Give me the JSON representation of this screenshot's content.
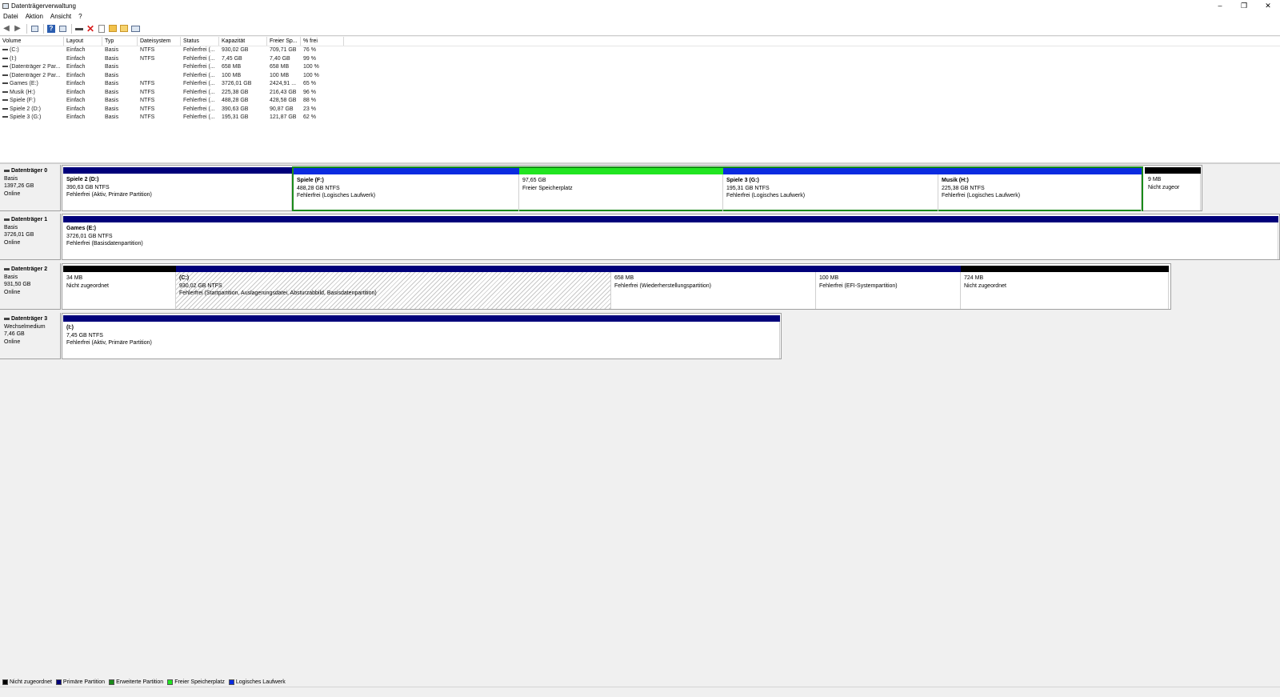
{
  "window": {
    "title": "Datenträgerverwaltung",
    "minimize": "–",
    "restore": "❐",
    "close": "✕"
  },
  "menu": [
    "Datei",
    "Aktion",
    "Ansicht",
    "?"
  ],
  "toolbar": {
    "back_icon": "arrow-left-icon",
    "forward_icon": "arrow-right-icon",
    "delete_icon": "red-x-icon"
  },
  "volume_table": {
    "headers": [
      "Volume",
      "Layout",
      "Typ",
      "Dateisystem",
      "Status",
      "Kapazität",
      "Freier Sp...",
      "% frei"
    ],
    "rows": [
      [
        "(C:)",
        "Einfach",
        "Basis",
        "NTFS",
        "Fehlerfrei (...",
        "930,02 GB",
        "709,71 GB",
        "76 %"
      ],
      [
        "(I:)",
        "Einfach",
        "Basis",
        "NTFS",
        "Fehlerfrei (...",
        "7,45 GB",
        "7,40 GB",
        "99 %"
      ],
      [
        "(Datenträger 2 Par...",
        "Einfach",
        "Basis",
        "",
        "Fehlerfrei (...",
        "658 MB",
        "658 MB",
        "100 %"
      ],
      [
        "(Datenträger 2 Par...",
        "Einfach",
        "Basis",
        "",
        "Fehlerfrei (...",
        "100 MB",
        "100 MB",
        "100 %"
      ],
      [
        "Games (E:)",
        "Einfach",
        "Basis",
        "NTFS",
        "Fehlerfrei (...",
        "3726,01 GB",
        "2424,91 ...",
        "65 %"
      ],
      [
        "Musik (H:)",
        "Einfach",
        "Basis",
        "NTFS",
        "Fehlerfrei (...",
        "225,38 GB",
        "216,43 GB",
        "96 %"
      ],
      [
        "Spiele (F:)",
        "Einfach",
        "Basis",
        "NTFS",
        "Fehlerfrei (...",
        "488,28 GB",
        "428,58 GB",
        "88 %"
      ],
      [
        "Spiele 2 (D:)",
        "Einfach",
        "Basis",
        "NTFS",
        "Fehlerfrei (...",
        "390,63 GB",
        "90,87 GB",
        "23 %"
      ],
      [
        "Spiele 3 (G:)",
        "Einfach",
        "Basis",
        "NTFS",
        "Fehlerfrei (...",
        "195,31 GB",
        "121,87 GB",
        "62 %"
      ]
    ]
  },
  "disks": [
    {
      "name": "Datenträger 0",
      "type": "Basis",
      "size": "1397,26 GB",
      "state": "Online",
      "partitions": [
        {
          "name": "Spiele 2  (D:)",
          "size": "390,63 GB NTFS",
          "status": "Fehlerfrei (Aktiv, Primäre Partition)",
          "color": "#00007a"
        },
        {
          "name": "Spiele  (F:)",
          "size": "488,28 GB NTFS",
          "status": "Fehlerfrei (Logisches Laufwerk)",
          "color": "#0a2be0"
        },
        {
          "name": "",
          "size": "97,65 GB",
          "status": "Freier Speicherplatz",
          "color": "#21e521"
        },
        {
          "name": "Spiele 3  (G:)",
          "size": "195,31 GB NTFS",
          "status": "Fehlerfrei (Logisches Laufwerk)",
          "color": "#0a2be0"
        },
        {
          "name": "Musik  (H:)",
          "size": "225,38 GB NTFS",
          "status": "Fehlerfrei (Logisches Laufwerk)",
          "color": "#0a2be0"
        },
        {
          "name": "",
          "size": "9 MB",
          "status": "Nicht zugeor",
          "color": "#000000"
        }
      ]
    },
    {
      "name": "Datenträger 1",
      "type": "Basis",
      "size": "3726,01 GB",
      "state": "Online",
      "partitions": [
        {
          "name": "Games  (E:)",
          "size": "3726,01 GB NTFS",
          "status": "Fehlerfrei (Basisdatenpartition)",
          "color": "#00007a"
        }
      ]
    },
    {
      "name": "Datenträger 2",
      "type": "Basis",
      "size": "931,50 GB",
      "state": "Online",
      "partitions": [
        {
          "name": "",
          "size": "34 MB",
          "status": "Nicht zugeordnet",
          "color": "#000000"
        },
        {
          "name": "(C:)",
          "size": "930,02 GB NTFS",
          "status": "Fehlerfrei (Startpartition, Auslagerungsdatei, Absturzabbild, Basisdatenpartition)",
          "color": "#00007a"
        },
        {
          "name": "",
          "size": "658 MB",
          "status": "Fehlerfrei (Wiederherstellungspartition)",
          "color": "#00007a"
        },
        {
          "name": "",
          "size": "100 MB",
          "status": "Fehlerfrei (EFI-Systempartition)",
          "color": "#00007a"
        },
        {
          "name": "",
          "size": "724 MB",
          "status": "Nicht zugeordnet",
          "color": "#000000"
        }
      ]
    },
    {
      "name": "Datenträger 3",
      "type": "Wechselmedium",
      "size": "7,46 GB",
      "state": "Online",
      "partitions": [
        {
          "name": "(I:)",
          "size": "7,45 GB NTFS",
          "status": "Fehlerfrei (Aktiv, Primäre Partition)",
          "color": "#00007a"
        }
      ]
    }
  ],
  "legend": [
    {
      "label": "Nicht zugeordnet",
      "color": "#000000"
    },
    {
      "label": "Primäre Partition",
      "color": "#00007a"
    },
    {
      "label": "Erweiterte Partition",
      "color": "#1a8a1a"
    },
    {
      "label": "Freier Speicherplatz",
      "color": "#21e521"
    },
    {
      "label": "Logisches Laufwerk",
      "color": "#0a2be0"
    }
  ]
}
